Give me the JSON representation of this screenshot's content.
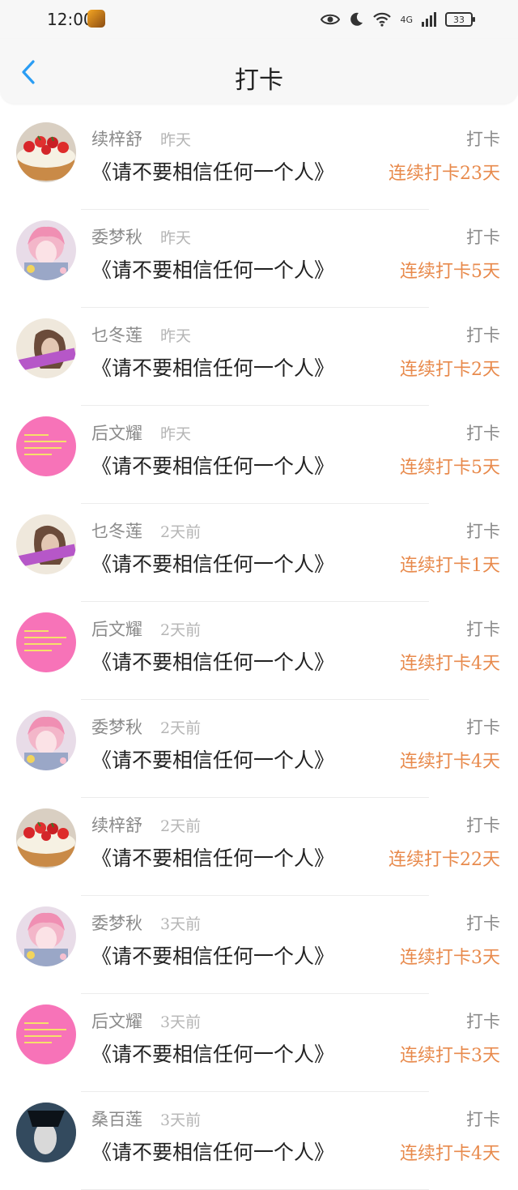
{
  "status_bar": {
    "time": "12:00",
    "network": "4G",
    "battery": "33"
  },
  "header": {
    "title": "打卡"
  },
  "entries": [
    {
      "name": "续梓舒",
      "time": "昨天",
      "book": "《请不要相信任何一个人》",
      "action": "打卡",
      "streak": "连续打卡23天",
      "avatar": "cake"
    },
    {
      "name": "委梦秋",
      "time": "昨天",
      "book": "《请不要相信任何一个人》",
      "action": "打卡",
      "streak": "连续打卡5天",
      "avatar": "anime"
    },
    {
      "name": "乜冬莲",
      "time": "昨天",
      "book": "《请不要相信任何一个人》",
      "action": "打卡",
      "streak": "连续打卡2天",
      "avatar": "girl"
    },
    {
      "name": "后文耀",
      "time": "昨天",
      "book": "《请不要相信任何一个人》",
      "action": "打卡",
      "streak": "连续打卡5天",
      "avatar": "pink"
    },
    {
      "name": "乜冬莲",
      "time": "2天前",
      "book": "《请不要相信任何一个人》",
      "action": "打卡",
      "streak": "连续打卡1天",
      "avatar": "girl"
    },
    {
      "name": "后文耀",
      "time": "2天前",
      "book": "《请不要相信任何一个人》",
      "action": "打卡",
      "streak": "连续打卡4天",
      "avatar": "pink"
    },
    {
      "name": "委梦秋",
      "time": "2天前",
      "book": "《请不要相信任何一个人》",
      "action": "打卡",
      "streak": "连续打卡4天",
      "avatar": "anime"
    },
    {
      "name": "续梓舒",
      "time": "2天前",
      "book": "《请不要相信任何一个人》",
      "action": "打卡",
      "streak": "连续打卡22天",
      "avatar": "cake"
    },
    {
      "name": "委梦秋",
      "time": "3天前",
      "book": "《请不要相信任何一个人》",
      "action": "打卡",
      "streak": "连续打卡3天",
      "avatar": "anime"
    },
    {
      "name": "后文耀",
      "time": "3天前",
      "book": "《请不要相信任何一个人》",
      "action": "打卡",
      "streak": "连续打卡3天",
      "avatar": "pink"
    },
    {
      "name": "桑百莲",
      "time": "3天前",
      "book": "《请不要相信任何一个人》",
      "action": "打卡",
      "streak": "连续打卡4天",
      "avatar": "dark"
    }
  ],
  "colors": {
    "streak": "#e88a4c",
    "back_arrow": "#2a9df4"
  }
}
